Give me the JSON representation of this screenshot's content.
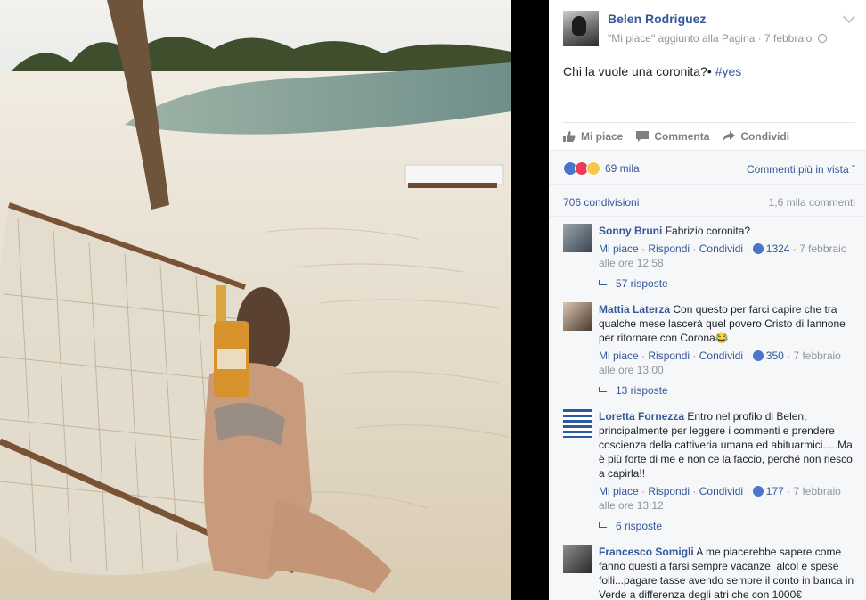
{
  "post": {
    "page_name": "Belen Rodriguez",
    "meta_action": "\"Mi piace\" aggiunto alla Pagina",
    "meta_date": "7 febbraio",
    "text": "Chi la vuole una coronita?•",
    "hashtag": "#yes"
  },
  "actions": {
    "like": "Mi piace",
    "comment": "Commenta",
    "share": "Condividi"
  },
  "stats": {
    "reactions": "69 mila",
    "more_comments": "Commenti più in vista ˇ",
    "shares": "706 condivisioni",
    "comments": "1,6 mila commenti"
  },
  "comments": [
    {
      "name": "Sonny Bruni",
      "text": "Fabrizio coronita?",
      "like": "Mi piace",
      "reply": "Rispondi",
      "share": "Condividi",
      "likes": "1324",
      "time": "7 febbraio alle ore 12:58",
      "replies": "57 risposte"
    },
    {
      "name": "Mattia Laterza",
      "text": "Con questo per farci capire che tra qualche mese lascerà quel povero Cristo di Iannone per ritornare con Corona😂",
      "like": "Mi piace",
      "reply": "Rispondi",
      "share": "Condividi",
      "likes": "350",
      "time": "7 febbraio alle ore 13:00",
      "replies": "13 risposte"
    },
    {
      "name": "Loretta Fornezza",
      "text": "Entro nel profilo di Belen, principalmente per leggere i commenti e prendere coscienza della cattiveria umana ed abituarmici.....Ma è più forte di me e non ce la faccio, perché non riesco a capirla!!",
      "like": "Mi piace",
      "reply": "Rispondi",
      "share": "Condividi",
      "likes": "177",
      "time": "7 febbraio alle ore 13:12",
      "replies": "6 risposte"
    },
    {
      "name": "Francesco Somigli",
      "text": "A me piacerebbe sapere come fanno questi a farsi sempre vacanze, alcol e spese folli...pagare tasse avendo sempre il conto in banca in Verde a differenza degli atri che con 1000€"
    }
  ],
  "colors": {
    "link": "#365899",
    "muted": "#90949c",
    "like_blue": "#4a76c9",
    "love_red": "#f0385a",
    "wow_yellow": "#f7c94a"
  }
}
